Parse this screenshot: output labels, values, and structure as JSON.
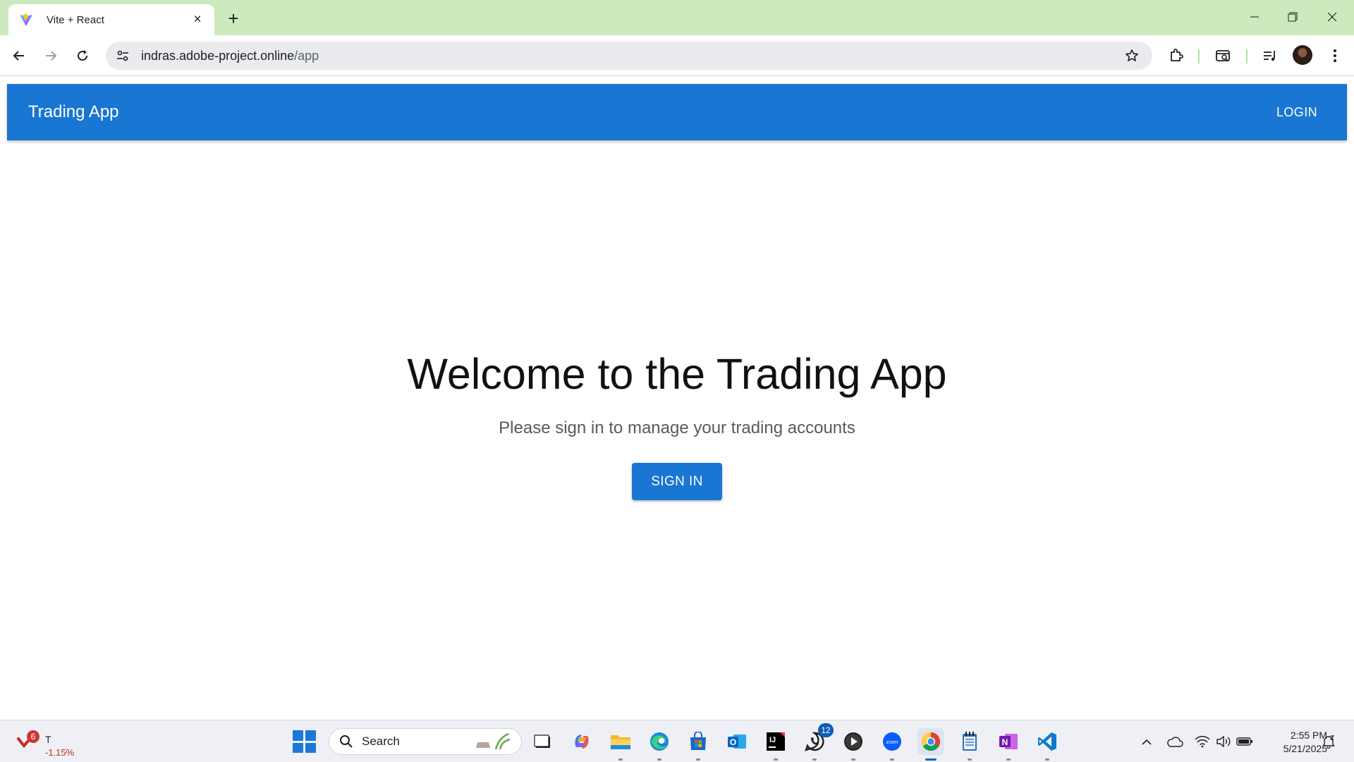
{
  "browser": {
    "tab": {
      "title": "Vite + React",
      "favicon": "vite-icon"
    },
    "new_tab": "+",
    "window_controls": {
      "minimize": "minimize-icon",
      "restore": "restore-icon",
      "close": "close-icon"
    },
    "url_host": "indras.adobe-project.online",
    "url_path": "/app"
  },
  "page": {
    "app_title": "Trading App",
    "login_label": "LOGIN",
    "heading": "Welcome to the Trading App",
    "subheading": "Please sign in to manage your trading accounts",
    "signin_label": "SIGN IN",
    "primary_color": "#1976d2"
  },
  "taskbar": {
    "widget": {
      "badge": "6",
      "ticker": "T",
      "change": "-1.15%"
    },
    "search_label": "Search",
    "apps": [
      "task-view",
      "copilot",
      "file-explorer",
      "edge",
      "microsoft-store",
      "outlook",
      "intellij",
      "whatsapp",
      "media-player",
      "zoom",
      "chrome",
      "notepad",
      "onenote",
      "vscode"
    ],
    "whatsapp_badge": "12",
    "clock": {
      "time": "2:55 PM",
      "date": "5/21/2025"
    }
  }
}
